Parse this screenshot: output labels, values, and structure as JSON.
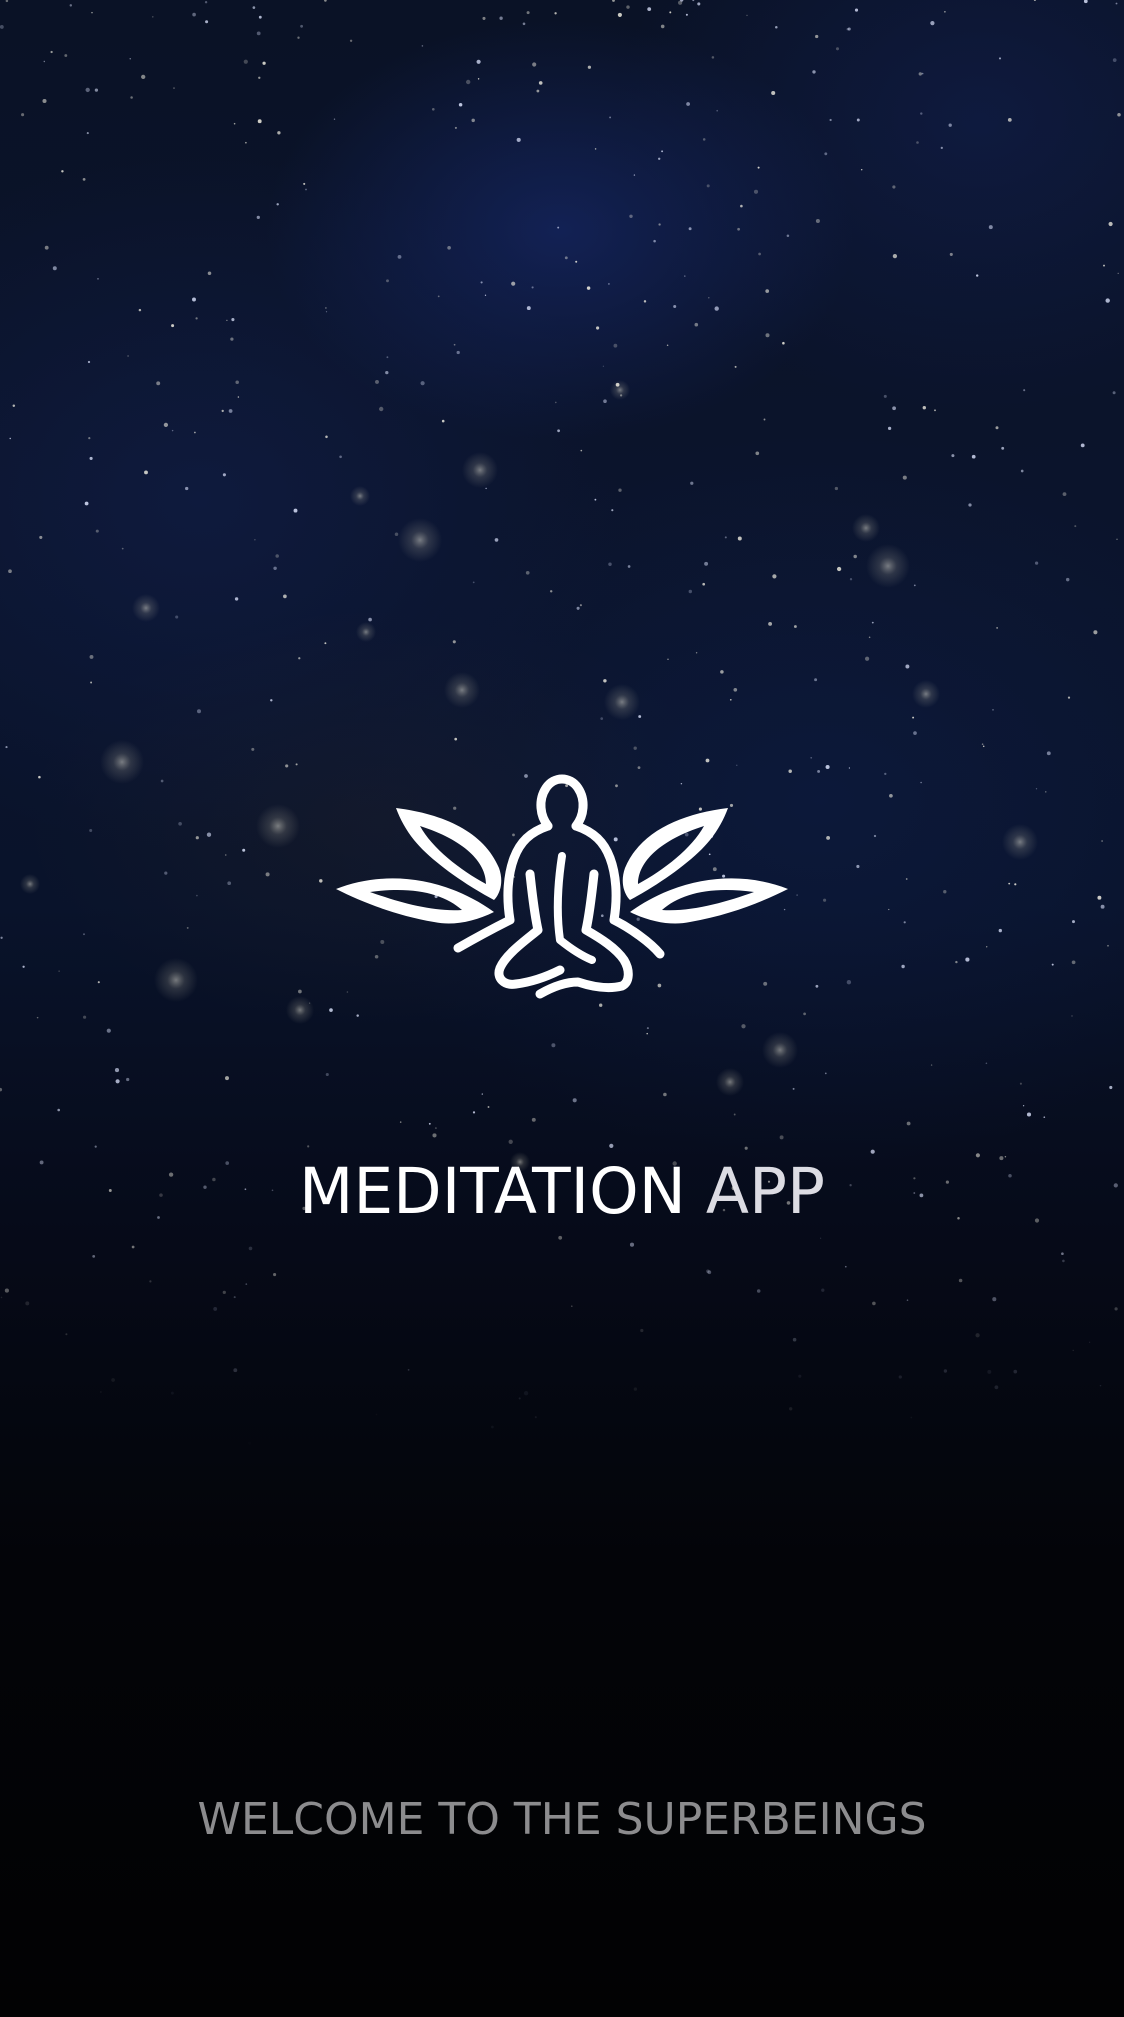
{
  "splash": {
    "title_primary": "MEDITATION",
    "title_secondary": "APP",
    "tagline": "WELCOME TO THE SUPERBEINGS",
    "logo_icon": "lotus-meditation-icon",
    "background": "starfield-night-sky"
  },
  "colors": {
    "title": "#ffffff",
    "tagline": "#8c8c8e",
    "background_top": "#0a1226",
    "background_bottom": "#020203"
  }
}
